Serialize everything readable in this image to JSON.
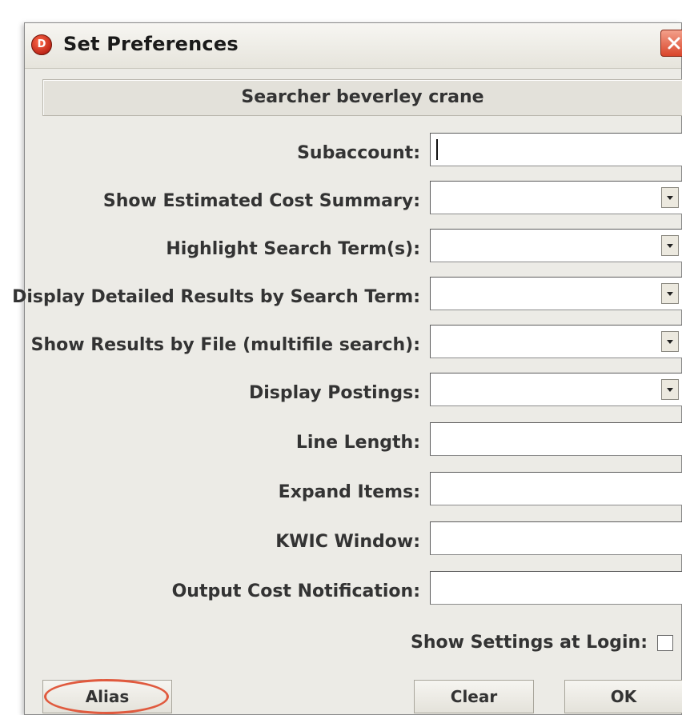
{
  "window": {
    "title": "Set Preferences",
    "app_icon_glyph": "D"
  },
  "searcher": {
    "text": "Searcher beverley crane"
  },
  "fields": [
    {
      "label": "Subaccount:",
      "type": "text",
      "value": ""
    },
    {
      "label": "Show Estimated Cost Summary:",
      "type": "dropdown",
      "value": ""
    },
    {
      "label": "Highlight Search Term(s):",
      "type": "dropdown",
      "value": ""
    },
    {
      "label": "Display Detailed Results by Search Term:",
      "type": "dropdown",
      "value": ""
    },
    {
      "label": "Show Results by File (multifile search):",
      "type": "dropdown",
      "value": ""
    },
    {
      "label": "Display Postings:",
      "type": "dropdown",
      "value": ""
    },
    {
      "label": "Line Length:",
      "type": "text",
      "value": ""
    },
    {
      "label": "Expand Items:",
      "type": "text",
      "value": ""
    },
    {
      "label": "KWIC Window:",
      "type": "text",
      "value": ""
    },
    {
      "label": "Output Cost Notification:",
      "type": "text",
      "value": ""
    }
  ],
  "show_settings": {
    "label": "Show Settings at Login:",
    "checked": false
  },
  "buttons": {
    "alias": "Alias",
    "clear": "Clear",
    "ok": "OK"
  },
  "colors": {
    "dialog_bg": "#ecebe6",
    "close_button": "#d9452a",
    "annotation_ring": "#e05a3e"
  }
}
